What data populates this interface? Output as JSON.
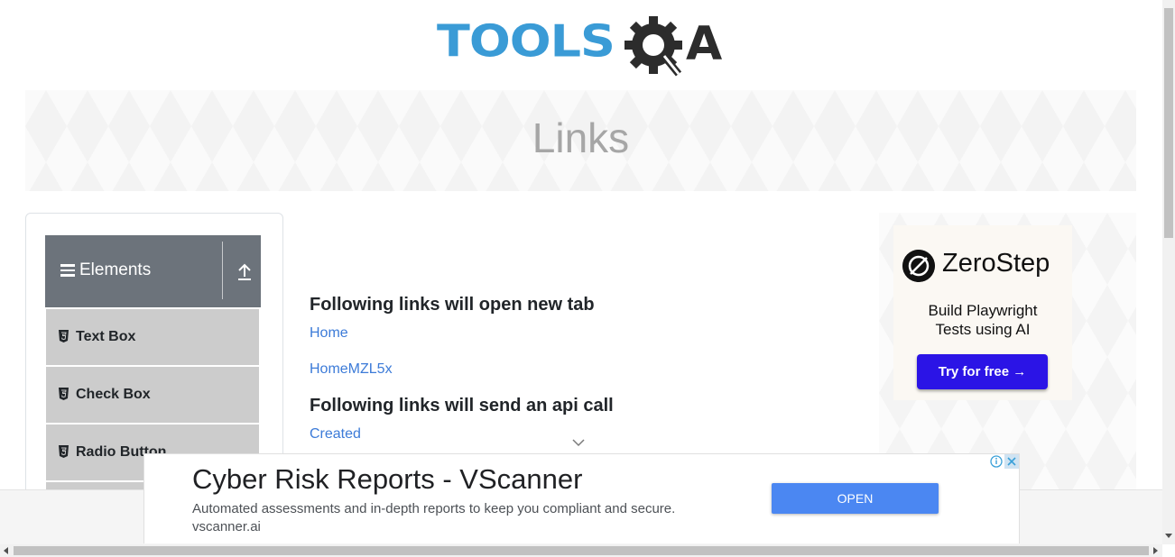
{
  "logo": {
    "text_tools": "TOOLS",
    "text_a": "A",
    "icon": "gear-magnifier-icon"
  },
  "banner": {
    "title": "Links"
  },
  "sidebar": {
    "group_title": "Elements",
    "group_icon": "hamburger-icon",
    "toggle_icon": "upload-arrow-icon",
    "items": [
      {
        "label": "Text Box",
        "icon": "html5-icon"
      },
      {
        "label": "Check Box",
        "icon": "html5-icon"
      },
      {
        "label": "Radio Button",
        "icon": "html5-icon"
      }
    ]
  },
  "main": {
    "heading_new_tab": "Following links will open new tab",
    "links_new_tab": [
      "Home",
      "HomeMZL5x"
    ],
    "heading_api": "Following links will send an api call",
    "links_api": [
      "Created"
    ]
  },
  "right_ad": {
    "brand": "ZeroStep",
    "tagline_line1": "Build Playwright",
    "tagline_line2": "Tests using AI",
    "cta": "Try for free →",
    "cta_color": "#2b14e6"
  },
  "bottom_ad": {
    "title": "Cyber Risk Reports - VScanner",
    "description": "Automated assessments and in-depth reports to keep you compliant and secure.",
    "url": "vscanner.ai",
    "button": "OPEN",
    "button_color": "#4b87f2"
  },
  "colors": {
    "link": "#3c7bd8",
    "logo_blue": "#3a9bd6",
    "sidebar_header": "#6c737b",
    "sidebar_item": "#cccccc"
  }
}
